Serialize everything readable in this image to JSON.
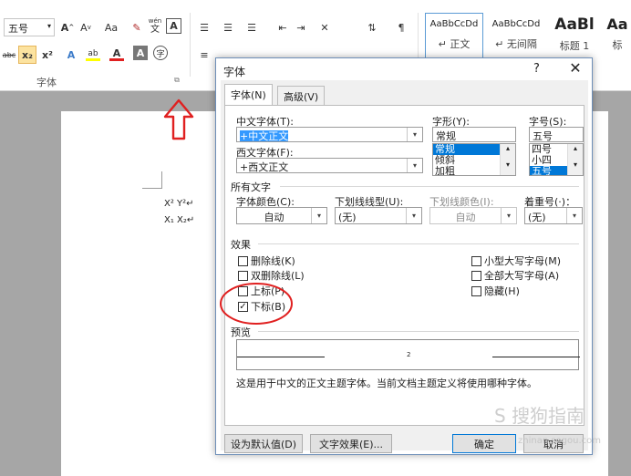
{
  "ribbon": {
    "font_size_value": "五号",
    "font_grow_label": "A",
    "font_shrink_label": "A",
    "change_case_label": "Aa",
    "phonetic_label": "wén",
    "phonetic_glyph": "文",
    "border_glyph": "A",
    "strike_label": "abc",
    "subscript_label": "x₂",
    "superscript_label": "x²",
    "text_effect_glyph": "A",
    "highlight_glyph": "ab",
    "font_color_glyph": "A",
    "char_shading_glyph": "A",
    "enclose_glyph": "字",
    "group_font_label": "字体",
    "styles": [
      {
        "sample": "AaBbCcDd",
        "name": "↵ 正文",
        "selected": true
      },
      {
        "sample": "AaBbCcDd",
        "name": "↵ 无间隔",
        "selected": false
      },
      {
        "sample": "AaBl",
        "name": "标题 1",
        "selected": false
      },
      {
        "sample": "Aa",
        "name": "标",
        "selected": false
      }
    ],
    "colors": {
      "font_color": "#e02020",
      "highlight": "#ffff00",
      "accent": "#2b579a"
    }
  },
  "document": {
    "line1": "X² Y²↵",
    "line2": "X₁ X₂↵"
  },
  "dialog": {
    "title": "字体",
    "help": "?",
    "close": "✕",
    "tabs": [
      {
        "label": "字体(N)",
        "active": true
      },
      {
        "label": "高级(V)",
        "active": false
      }
    ],
    "chinese_font_label": "中文字体(T):",
    "chinese_font_value": "+中文正文",
    "western_font_label": "西文字体(F):",
    "western_font_value": "+西文正文",
    "style_label": "字形(Y):",
    "style_value": "常规",
    "style_options": [
      "常规",
      "倾斜",
      "加粗"
    ],
    "size_label": "字号(S):",
    "size_value": "五号",
    "size_options": [
      "四号",
      "小四",
      "五号"
    ],
    "all_text_label": "所有文字",
    "font_color_label": "字体颜色(C):",
    "font_color_value": "自动",
    "underline_type_label": "下划线线型(U):",
    "underline_type_value": "(无)",
    "underline_color_label": "下划线颜色(I):",
    "underline_color_value": "自动",
    "emphasis_label": "着重号(·)：",
    "emphasis_value": "(无)",
    "effects_label": "效果",
    "effects": [
      {
        "label": "删除线(K)",
        "checked": false
      },
      {
        "label": "双删除线(L)",
        "checked": false
      },
      {
        "label": "上标(P)",
        "checked": false
      },
      {
        "label": "下标(B)",
        "checked": true
      },
      {
        "label": "小型大写字母(M)",
        "checked": false
      },
      {
        "label": "全部大写字母(A)",
        "checked": false
      },
      {
        "label": "隐藏(H)",
        "checked": false
      }
    ],
    "preview_label": "预览",
    "preview_sample": "2",
    "preview_note": "这是用于中文的正文主题字体。当前文档主题定义将使用哪种字体。",
    "buttons": {
      "set_default": "设为默认值(D)",
      "text_effects": "文字效果(E)...",
      "ok": "确定",
      "cancel": "取消"
    }
  },
  "watermark": {
    "text": "搜狗指南",
    "url": "zhinan.sogou.com"
  }
}
